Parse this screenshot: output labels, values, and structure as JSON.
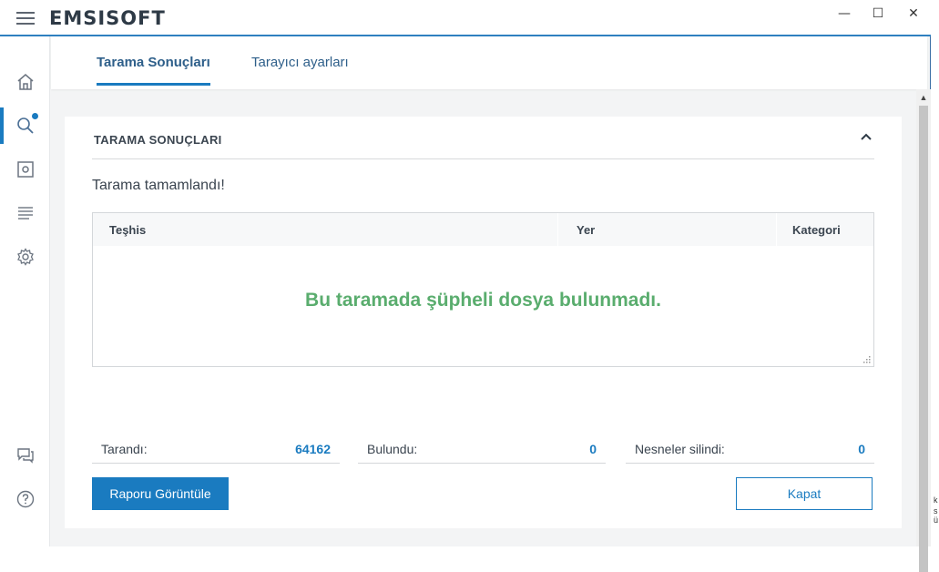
{
  "app": {
    "logo": "EMSISOFT"
  },
  "window_controls": {
    "minimize": "—",
    "maximize": "☐",
    "close": "✕"
  },
  "sidebar": {
    "items": [
      {
        "name": "home"
      },
      {
        "name": "scan",
        "active": true,
        "badge": true
      },
      {
        "name": "quarantine"
      },
      {
        "name": "logs"
      },
      {
        "name": "settings"
      },
      {
        "name": "feedback"
      },
      {
        "name": "help"
      }
    ]
  },
  "tabs": [
    {
      "label": "Tarama Sonuçları",
      "active": true
    },
    {
      "label": "Tarayıcı ayarları",
      "active": false
    }
  ],
  "card": {
    "title": "TARAMA SONUÇLARI",
    "status": "Tarama tamamlandı!"
  },
  "table": {
    "columns": [
      "Teşhis",
      "Yer",
      "Kategori"
    ],
    "empty_message": "Bu taramada şüpheli dosya bulunmadı."
  },
  "stats": [
    {
      "label": "Tarandı:",
      "value": "64162"
    },
    {
      "label": "Bulundu:",
      "value": "0"
    },
    {
      "label": "Nesneler silindi:",
      "value": "0"
    }
  ],
  "buttons": {
    "view_report": "Raporu Görüntüle",
    "close": "Kapat"
  },
  "right_edge_chars": [
    "k",
    "s",
    "ü"
  ],
  "colors": {
    "accent": "#1a7bc0",
    "success_text": "#5aad6e"
  }
}
